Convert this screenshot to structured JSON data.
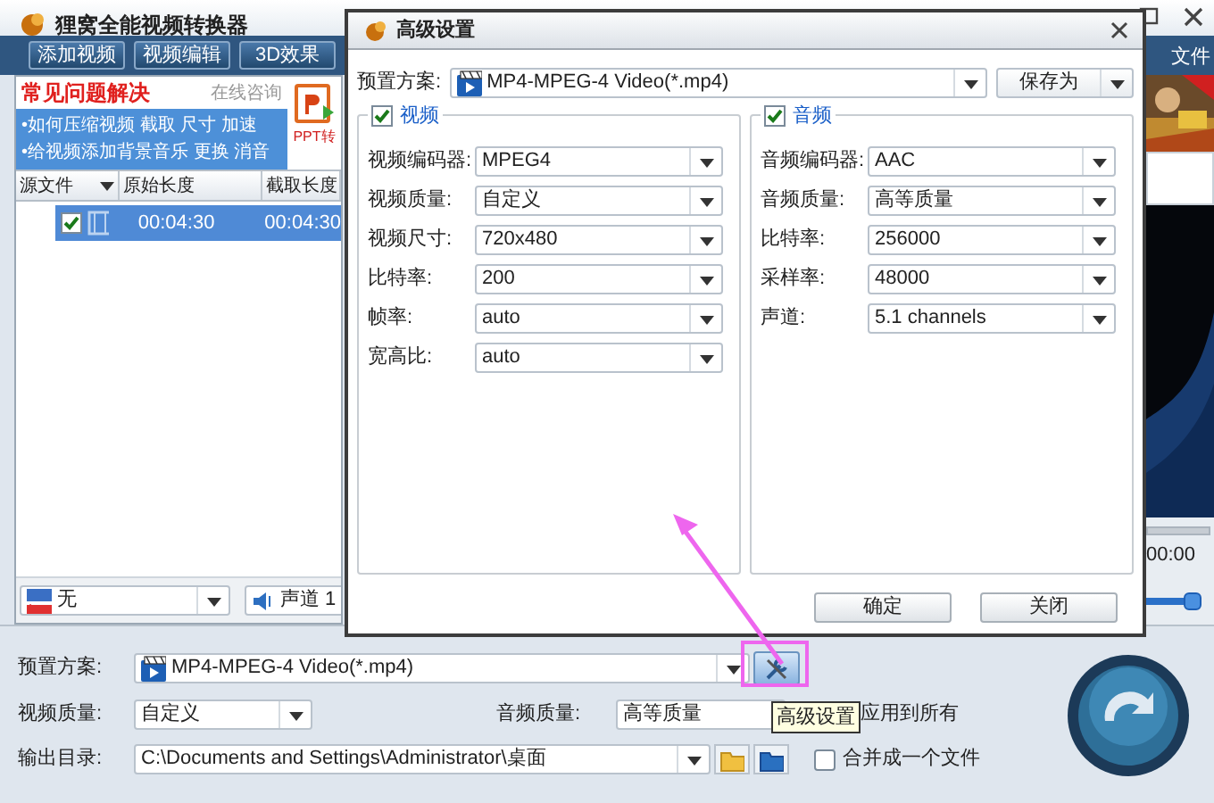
{
  "window": {
    "title": "狸窝全能视频转换器",
    "toolbar": [
      "添加视频",
      "视频编辑",
      "3D效果"
    ],
    "menu_text": "文件"
  },
  "faq": {
    "title": "常见问题解决",
    "consult": "在线咨询",
    "lines": [
      "•如何压缩视频 截取 尺寸 加速",
      "•给视频添加背景音乐 更换 消音"
    ],
    "ppt_label": "PPT转"
  },
  "file_table": {
    "columns": [
      "源文件",
      "原始长度",
      "截取长度"
    ],
    "rows": [
      {
        "checked": true,
        "selected": true,
        "original": "00:04:30",
        "clip": "00:04:30"
      }
    ]
  },
  "subtitle": "无",
  "audio_track": "声道 1",
  "preview": {
    "time": "00:00",
    "volume": {
      "level": 0.8
    }
  },
  "bottom": {
    "preset_label": "预置方案:",
    "preset": "MP4-MPEG-4 Video(*.mp4)",
    "video_quality_label": "视频质量:",
    "video_quality": "自定义",
    "audio_quality_label": "音频质量:",
    "audio_quality": "高等质量",
    "apply_all": "应用到所有",
    "output_label": "输出目录:",
    "output_path": "C:\\Documents and Settings\\Administrator\\桌面",
    "merge": {
      "label": "合并成一个文件",
      "checked": false
    }
  },
  "tooltip": "高级设置",
  "dialog": {
    "title": "高级设置",
    "preset_label": "预置方案:",
    "preset": "MP4-MPEG-4 Video(*.mp4)",
    "save_as": "保存为",
    "groups": [
      {
        "title": "视频",
        "checked": true,
        "fields": [
          {
            "label": "视频编码器:",
            "value": "MPEG4"
          },
          {
            "label": "视频质量:",
            "value": "自定义"
          },
          {
            "label": "视频尺寸:",
            "value": "720x480"
          },
          {
            "label": "比特率:",
            "value": "200"
          },
          {
            "label": "帧率:",
            "value": "auto"
          },
          {
            "label": "宽高比:",
            "value": "auto"
          }
        ]
      },
      {
        "title": "音频",
        "checked": true,
        "fields": [
          {
            "label": "音频编码器:",
            "value": "AAC"
          },
          {
            "label": "音频质量:",
            "value": "高等质量"
          },
          {
            "label": "比特率:",
            "value": "256000"
          },
          {
            "label": "采样率:",
            "value": "48000"
          },
          {
            "label": "声道:",
            "value": "5.1 channels"
          }
        ]
      }
    ],
    "buttons": [
      "确定",
      "关闭"
    ]
  }
}
